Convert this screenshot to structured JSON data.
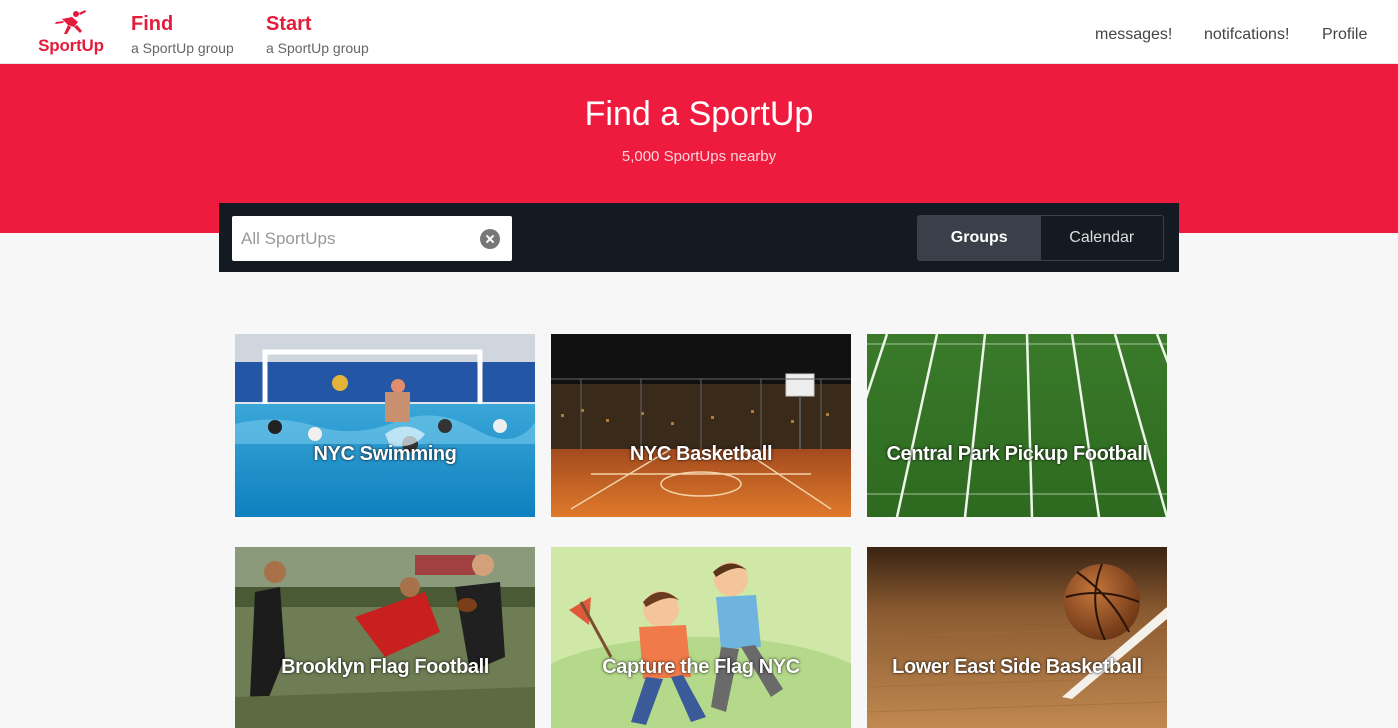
{
  "brand": {
    "name": "SportUp",
    "accent": "#e41c3c"
  },
  "nav": {
    "find": {
      "main": "Find",
      "sub": "a SportUp group"
    },
    "start": {
      "main": "Start",
      "sub": "a SportUp group"
    },
    "right": {
      "messages": "messages!",
      "notifications": "notifcations!",
      "profile": "Profile"
    }
  },
  "hero": {
    "title": "Find a SportUp",
    "subtitle": "5,000 SportUps nearby",
    "bg": "#ef1b3e"
  },
  "search": {
    "placeholder": "All SportUps",
    "value": ""
  },
  "view_toggle": {
    "groups": "Groups",
    "calendar": "Calendar",
    "selected": "Groups"
  },
  "groups": [
    {
      "name": "NYC Swimming",
      "image": "water-polo-pool"
    },
    {
      "name": "NYC Basketball",
      "image": "rooftop-basketball-court-night"
    },
    {
      "name": "Central Park Pickup Football",
      "image": "football-field-turf"
    },
    {
      "name": "Brooklyn Flag Football",
      "image": "flag-football-players"
    },
    {
      "name": "Capture the Flag NYC",
      "image": "capture-the-flag-illustration"
    },
    {
      "name": "Lower East Side Basketball",
      "image": "basketball-on-wood-court"
    }
  ]
}
